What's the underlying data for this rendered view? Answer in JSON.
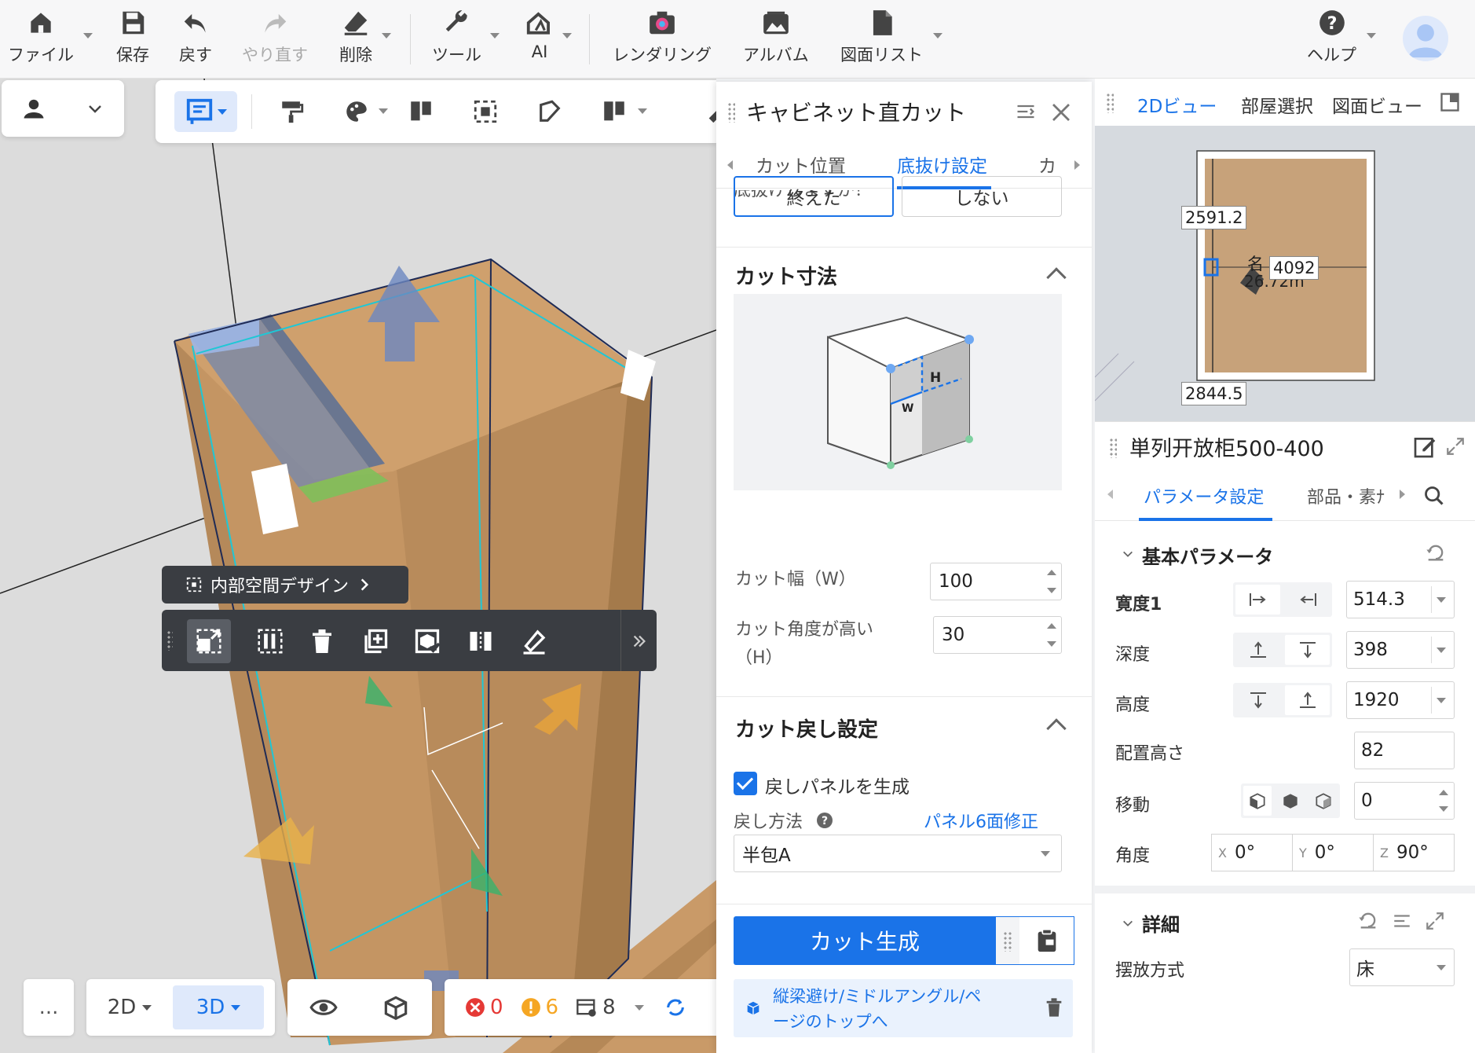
{
  "toolbar": {
    "file": "ファイル",
    "save": "保存",
    "undo": "戻す",
    "redo": "やり直す",
    "delete": "削除",
    "tools": "ツール",
    "ai": "AI",
    "render": "レンダリング",
    "album": "アルバム",
    "drawings": "図面リスト",
    "help": "ヘルプ"
  },
  "viewport": {
    "inner_space_label": "内部空間デザイン",
    "bottom": {
      "view_2d": "2D",
      "view_3d": "3D",
      "errors": "0",
      "warnings": "6",
      "items": "8",
      "more": "..."
    }
  },
  "cut_panel": {
    "title": "キャビネット直カット",
    "tabs": [
      "カット位置",
      "底抜け設定",
      "カ"
    ],
    "question_partial": "底抜けしますか？",
    "option_done": "終えた",
    "option_none": "しない",
    "cut_size_title": "カット寸法",
    "diagram_h": "H",
    "diagram_w": "W",
    "cut_width_label": "カット幅（W）",
    "cut_width_value": "100",
    "cut_height_label_1": "カット角度が高い",
    "cut_height_label_2": "（H）",
    "cut_height_value": "30",
    "return_title": "カット戻し設定",
    "generate_return_panel": "戻しパネルを生成",
    "return_method_label": "戻し方法",
    "panel_fix_link": "パネル6面修正",
    "return_method_value": "半包A",
    "generate_button": "カット生成",
    "note_text_1": "縦梁避け/ミドルアングル/ペ",
    "note_text_2": "ージのトップへ"
  },
  "view2d": {
    "tabs": [
      "2Dビュー",
      "部屋選択",
      "図面ビュー"
    ],
    "dims": {
      "top": "2591.2",
      "right": "4092",
      "bottom": "2844.5",
      "name_partial": "名",
      "area_partial": "26.72m"
    }
  },
  "props": {
    "title": "単列开放柜500-400",
    "tabs": [
      "パラメータ設定",
      "部品・素ﾅ"
    ],
    "basic_section": "基本パラメータ",
    "width_label": "寛度1",
    "width_value": "514.3",
    "depth_label": "深度",
    "depth_value": "398",
    "height_label": "高度",
    "height_value": "1920",
    "place_height_label": "配置高さ",
    "place_height_value": "82",
    "move_label": "移動",
    "move_value": "0",
    "angle_label": "角度",
    "angle_x_label": "X",
    "angle_x": "0°",
    "angle_y_label": "Y",
    "angle_y": "0°",
    "angle_z_label": "Z",
    "angle_z": "90°",
    "detail_section": "詳細",
    "placement_label": "摆放方式",
    "placement_value": "床"
  },
  "colors": {
    "accent": "#1a73e8",
    "error": "#e53935",
    "warning": "#f5a623"
  }
}
